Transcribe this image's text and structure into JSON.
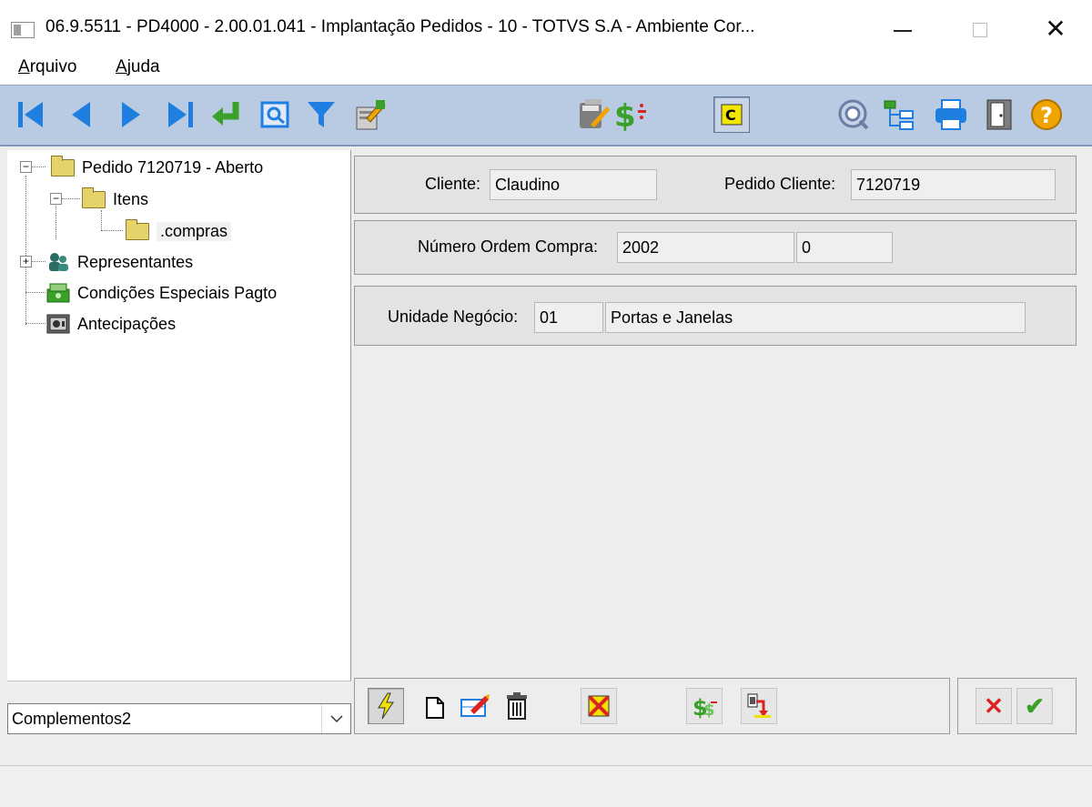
{
  "window": {
    "title": "06.9.5511 - PD4000 - 2.00.01.041 - Implantação Pedidos - 10 - TOTVS S.A - Ambiente Cor...",
    "minimize": "minimize",
    "maximize": "maximize",
    "close": "✕"
  },
  "menu": {
    "items": [
      {
        "hot": "A",
        "rest": "rquivo"
      },
      {
        "hot": "A",
        "rest": "juda"
      }
    ]
  },
  "toolbar": {
    "icons": [
      "first-record-icon",
      "previous-record-icon",
      "next-record-icon",
      "last-record-icon",
      "goto-icon",
      "search-icon",
      "filter-icon",
      "edit-icon",
      "calculator-icon",
      "dollar-icon",
      "copy-order-icon",
      "query-icon",
      "tree-structure-icon",
      "print-icon",
      "exit-icon",
      "help-icon"
    ],
    "help_glyph": "?"
  },
  "tree": {
    "nodes": [
      {
        "label": "Pedido 7120719 - Aberto",
        "expander": "−"
      },
      {
        "label": "Itens",
        "expander": "−"
      },
      {
        "label": ".compras"
      },
      {
        "label": "Representantes",
        "expander": "+"
      },
      {
        "label": "Condições Especiais Pagto"
      },
      {
        "label": "Antecipações"
      }
    ]
  },
  "complementos": {
    "selected": "Complementos2",
    "arrow": "⌵"
  },
  "form": {
    "cliente_label": "Cliente:",
    "cliente_value": "Claudino",
    "pedido_cliente_label": "Pedido Cliente:",
    "pedido_cliente_value": "7120719",
    "ordem_compra_label": "Número Ordem Compra:",
    "ordem_compra_value": "2002",
    "ordem_compra_seq": "0",
    "unidade_label": "Unidade Negócio:",
    "unidade_code": "01",
    "unidade_desc": "Portas e Janelas"
  },
  "actions": {
    "cancel": "✕",
    "confirm": "✔"
  },
  "colors": {
    "toolbar_bg": "#b9cbe2",
    "nav_blue": "#1f7fe0",
    "green": "#3aa02a",
    "help_orange": "#f0a400"
  }
}
